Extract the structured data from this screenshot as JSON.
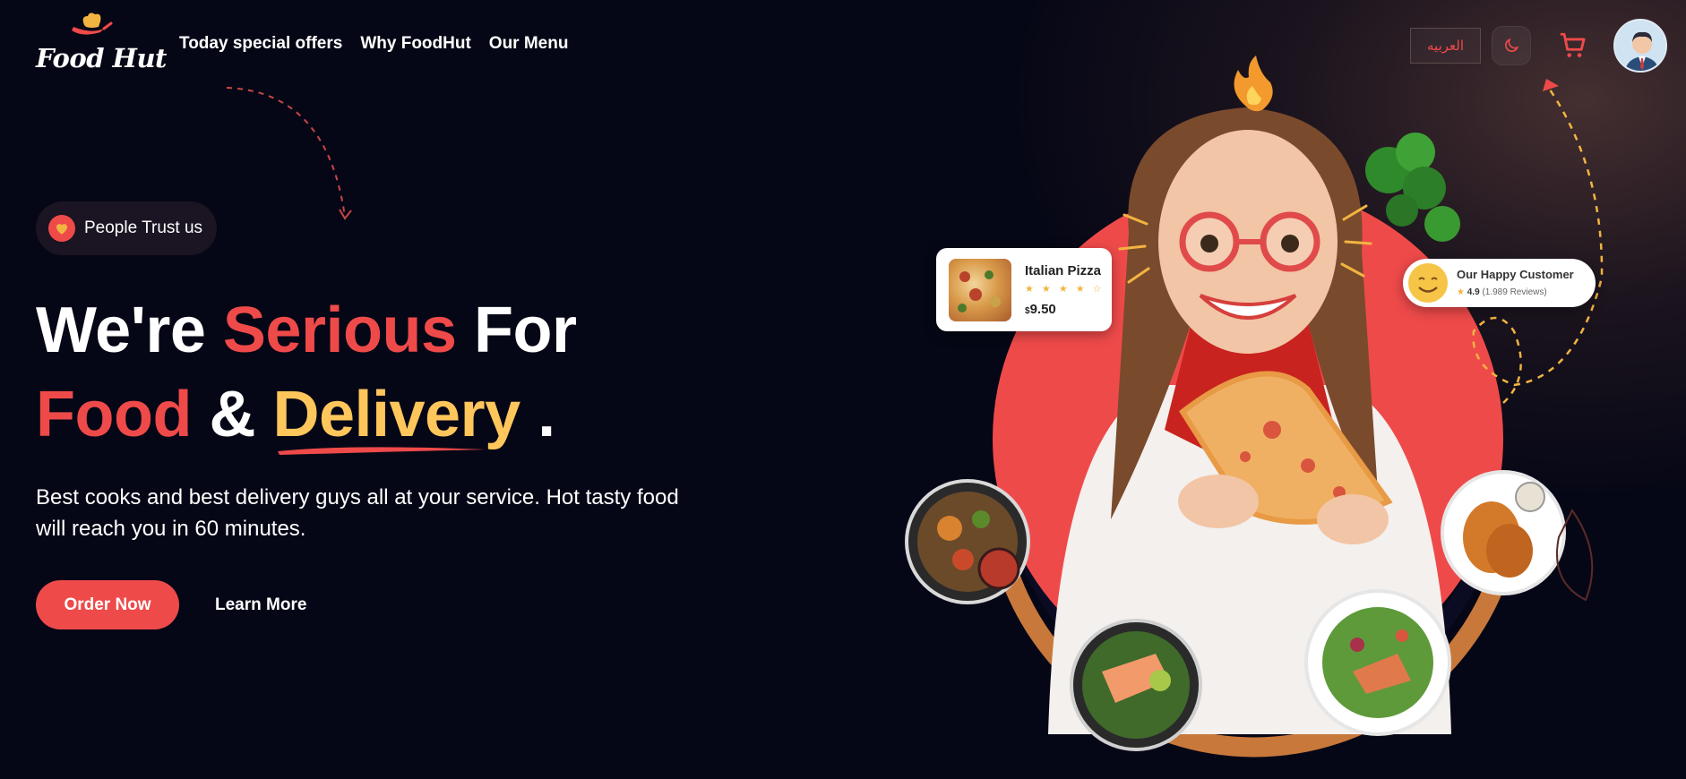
{
  "brand": {
    "logo_text": "Food Hut"
  },
  "nav": {
    "items": [
      {
        "label": "Today special offers"
      },
      {
        "label": "Why FoodHut"
      },
      {
        "label": "Our Menu"
      }
    ]
  },
  "header_actions": {
    "language_label": "العربيه",
    "theme_icon": "moon-icon",
    "cart_icon": "cart-icon",
    "avatar_icon": "user-avatar"
  },
  "hero": {
    "badge_label": "People Trust us",
    "headline": {
      "line1_part1": "We're",
      "line1_part2": "Serious",
      "line1_part3": "For",
      "line2_part1": "Food",
      "line2_part2": "&",
      "line2_part3": "Delivery",
      "line2_part4": "."
    },
    "subtext": "Best cooks and best delivery guys all at your service. Hot tasty food will reach you in 60 minutes.",
    "primary_button": "Order Now",
    "secondary_button": "Learn More"
  },
  "cards": {
    "pizza": {
      "name": "Italian Pizza",
      "stars": "★ ★ ★ ★ ☆",
      "rating": 4,
      "currency": "$",
      "price": "9.50"
    },
    "customer": {
      "title": "Our Happy Customer",
      "rating": "4.9",
      "reviews": "(1.989 Reviews)"
    }
  },
  "colors": {
    "background": "#060716",
    "accent_red": "#ef4a4a",
    "accent_yellow": "#ffc65c",
    "arc_orange": "#c8783a"
  }
}
